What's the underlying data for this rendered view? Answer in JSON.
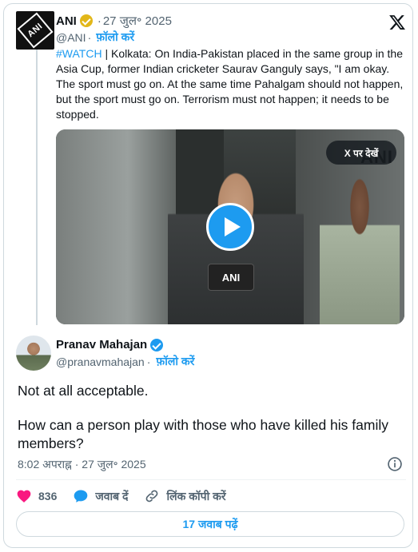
{
  "quoted_tweet": {
    "author_name": "ANI",
    "date": "27 जुल॰ 2025",
    "handle": "@ANI",
    "follow_label": "फ़ॉलो करें",
    "hashtag": "#WATCH",
    "text": " | Kolkata: On India-Pakistan placed in the same group in the Asia Cup, former Indian cricketer Saurav Ganguly says, \"I am okay. The sport must go on. At the same time Pahalgam should not happen, but the sport must go on. Terrorism must not happen; it needs to be stopped.",
    "avatar_text": "ANI",
    "video": {
      "watch_label": "X पर देखें",
      "mic_label": "ANI",
      "watermark": "ANI"
    }
  },
  "main_tweet": {
    "author_name": "Pranav Mahajan",
    "handle": "@pranavmahajan",
    "follow_label": "फ़ॉलो करें",
    "text_line1": "Not at all acceptable.",
    "text_line2": "How can a person play with those who have killed his family members?",
    "timestamp": "8:02 अपराह्न · 27 जुल॰ 2025"
  },
  "actions": {
    "likes": "836",
    "reply_label": "जवाब दें",
    "copy_link_label": "लिंक कॉपी करें"
  },
  "replies_button": "17 जवाब पढ़ें",
  "colors": {
    "accent": "#1d9bf0",
    "like": "#f91880",
    "gold_badge": "#e2b719"
  },
  "icons": {
    "x_logo": "x-logo-icon",
    "info": "info-icon",
    "heart": "heart-icon",
    "reply": "reply-bubble-icon",
    "link": "link-icon",
    "play": "play-icon"
  }
}
